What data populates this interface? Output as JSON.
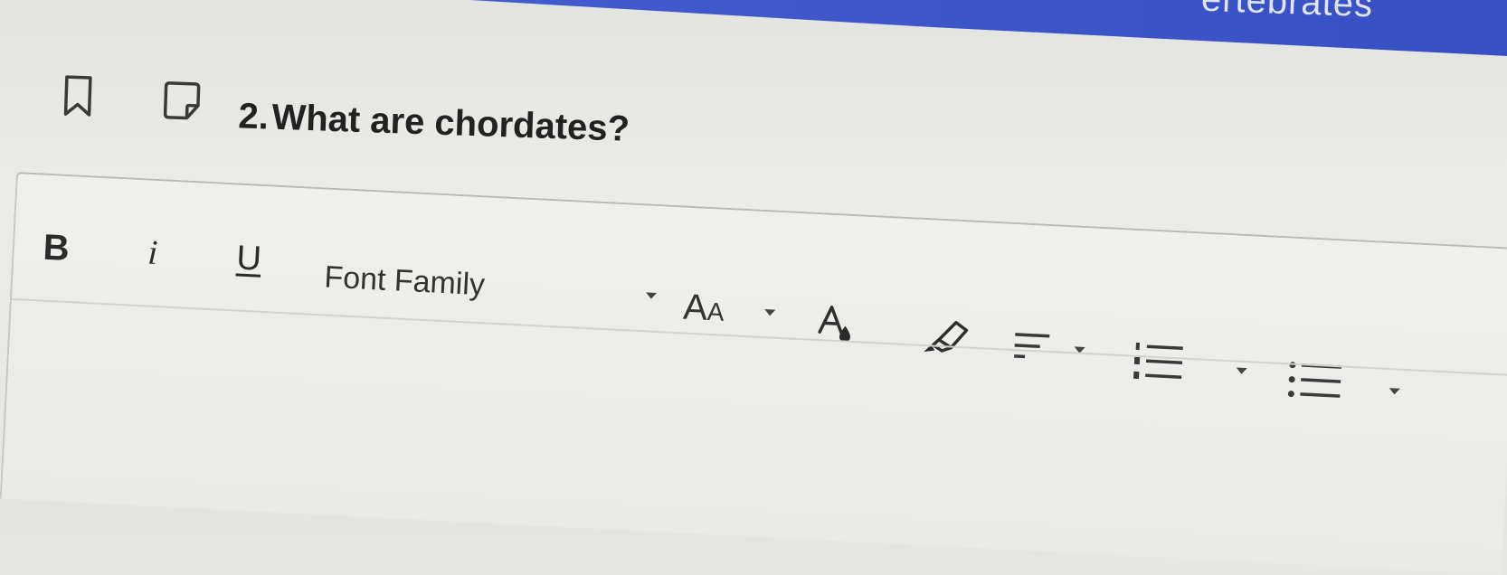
{
  "banner": {
    "text": "ertebrates",
    "color": "#3d56c9"
  },
  "question": {
    "number": "2.",
    "text": "What are chordates?",
    "bookmark_icon": "bookmark-icon",
    "flag_icon": "flag-icon"
  },
  "toolbar": {
    "bold_label": "B",
    "italic_label": "i",
    "underline_label": "U",
    "font_family_label": "Font Family",
    "font_size_label_large": "A",
    "font_size_label_small": "A",
    "icons": {
      "text_color": "text-color-icon",
      "highlight": "highlighter-icon",
      "align": "align-left-icon",
      "numbered_list": "numbered-list-icon",
      "bullet_list": "bullet-list-icon",
      "dropdown": "chevron-down-icon"
    }
  }
}
